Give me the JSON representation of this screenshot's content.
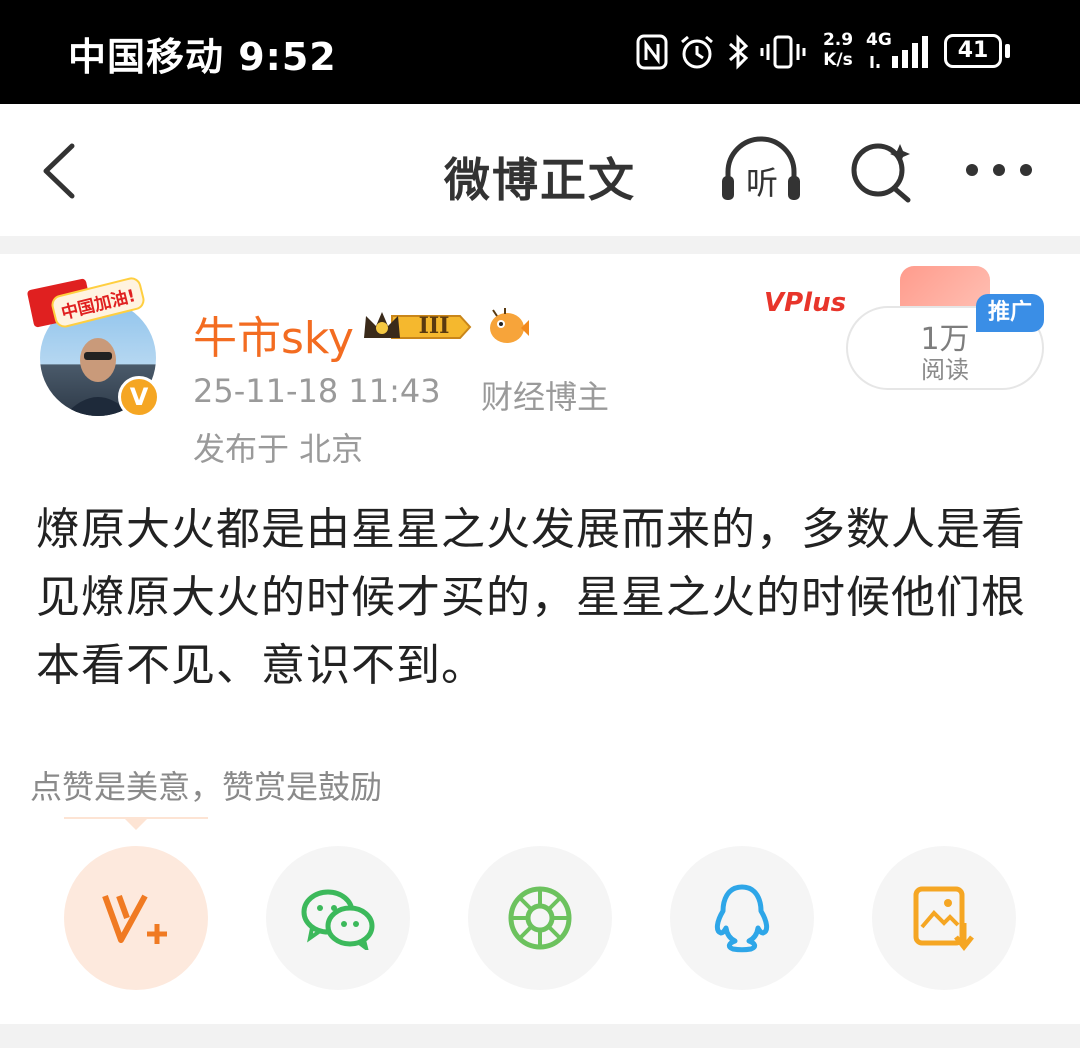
{
  "status_bar": {
    "carrier_time": "中国移动 9:52",
    "network_speed_value": "2.9",
    "network_speed_unit": "K/s",
    "network_type": "4G",
    "battery": "41",
    "icons": [
      "nfc-icon",
      "alarm-icon",
      "bluetooth-icon",
      "vibrate-icon",
      "signal-icon",
      "battery-icon"
    ]
  },
  "nav": {
    "title": "微博正文",
    "listen_label": "听",
    "icons": [
      "back-icon",
      "listen-icon",
      "search-icon",
      "more-icon"
    ]
  },
  "post": {
    "avatar_frame_label": "中国加油!",
    "username": "牛市sky",
    "level": "III",
    "time": "25-11-18 11:43",
    "role": "财经博主",
    "location": "发布于 北京",
    "verified_mark": "V",
    "vplus_label": "VPlus",
    "reads_count": "1万",
    "reads_label": "阅读",
    "promo_label": "推广",
    "content": "燎原大火都是由星星之火发展而来的，多数人是看见燎原大火的时候才买的，星星之火的时候他们根本看不见、意识不到。"
  },
  "share": {
    "hint": "点赞是美意，赞赏是鼓励",
    "buttons": [
      {
        "name": "vplus-share",
        "color": "#f07a22"
      },
      {
        "name": "wechat-share",
        "color": "#3cb95b"
      },
      {
        "name": "moments-share",
        "color": "#6cc25e"
      },
      {
        "name": "qq-share",
        "color": "#2ea6e8"
      },
      {
        "name": "save-image-share",
        "color": "#f5a623"
      }
    ]
  }
}
